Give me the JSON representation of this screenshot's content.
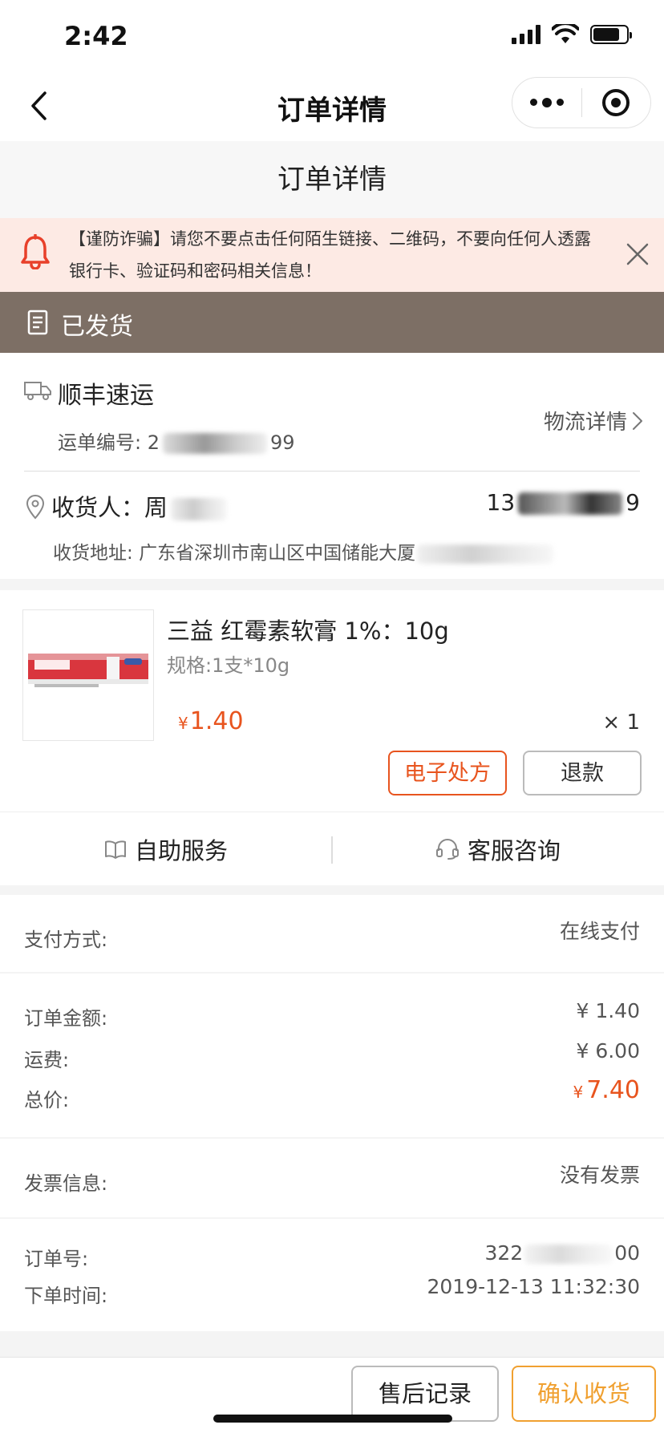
{
  "status_bar": {
    "time": "2:42"
  },
  "nav": {
    "title": "订单详情"
  },
  "page_header": {
    "title": "订单详情"
  },
  "warning": {
    "text": "【谨防诈骗】请您不要点击任何陌生链接、二维码，不要向任何人透露银行卡、验证码和密码相关信息！"
  },
  "order_status": {
    "label": "已发货"
  },
  "logistics": {
    "carrier": "顺丰速运",
    "waybill_label": "运单编号: ",
    "waybill_prefix": "2",
    "waybill_suffix": "99",
    "detail_link": "物流详情"
  },
  "receiver": {
    "label": "收货人：",
    "name_prefix": "周",
    "phone_prefix": "13",
    "phone_suffix": "9",
    "address_label": "收货地址: ",
    "address": "广东省深圳市南山区中国储能大厦"
  },
  "product": {
    "name": "三益 红霉素软膏 1%：10g",
    "spec": "规格:1支*10g",
    "currency": "¥",
    "price": "1.40",
    "qty": "× 1",
    "thumb_label": "红霉素软膏",
    "prescription_button": "电子处方",
    "refund_button": "退款"
  },
  "services": {
    "self_service": "自助服务",
    "customer_service": "客服咨询"
  },
  "payment": {
    "label": "支付方式:",
    "value": "在线支付"
  },
  "amounts": {
    "order_label": "订单金额:",
    "order_value": "¥ 1.40",
    "shipping_label": "运费:",
    "shipping_value": "¥ 6.00",
    "total_label": "总价:",
    "total_currency": "¥",
    "total_value": "7.40"
  },
  "invoice": {
    "label": "发票信息:",
    "value": "没有发票"
  },
  "order_info": {
    "number_label": "订单号:",
    "number_prefix": "322",
    "number_suffix": "00",
    "time_label": "下单时间:",
    "time_value": "2019-12-13 11:32:30"
  },
  "bottom": {
    "after_sales": "售后记录",
    "confirm": "确认收货"
  },
  "colors": {
    "accent_orange": "#e8541e",
    "confirm_orange": "#f0a030",
    "status_strip": "#7d6f65",
    "warning_bg": "#fdeae4",
    "bell_red": "#e8402a"
  }
}
